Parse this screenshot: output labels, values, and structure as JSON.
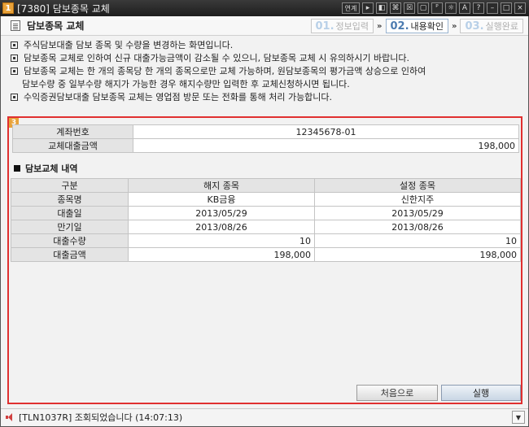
{
  "window": {
    "badge": "1",
    "title": "[7380] 담보종목 교체",
    "buttons": [
      "연계",
      "▸",
      "◧",
      "⌘",
      "☒",
      "▢",
      "ᴾ",
      "☼",
      "A",
      "?",
      "–",
      "□",
      "×"
    ]
  },
  "header": {
    "title": "담보종목 교체",
    "steps": [
      {
        "num": "01.",
        "label": "정보입력",
        "active": false
      },
      {
        "num": "02.",
        "label": "내용확인",
        "active": true
      },
      {
        "num": "03.",
        "label": "실행완료",
        "active": false
      }
    ],
    "arrow": "»"
  },
  "notices": [
    "주식담보대출 담보 종목 및 수량을 변경하는 화면입니다.",
    "담보종목 교체로 인하여 신규 대출가능금액이 감소될 수 있으니, 담보종목 교체 시 유의하시기 바랍니다.",
    "담보종목 교체는 한 개의 종목당 한 개의 종목으로만 교체 가능하며, 원담보종목의 평가금액 상승으로 인하여",
    "담보수량 중 일부수량 해지가 가능한 경우 해지수량만 입력한 후 교체신청하시면 됩니다.",
    "수익증권담보대출 담보종목 교체는 영업점 방문 또는 전화를 통해 처리 가능합니다."
  ],
  "panel": {
    "badge": "3",
    "account_label": "계좌번호",
    "account_value": "12345678-01",
    "loan_label": "교체대출금액",
    "loan_value": "198,000",
    "section_title": "담보교체 내역",
    "table": {
      "headers": [
        "구분",
        "해지 종목",
        "설정 종목"
      ],
      "rows": [
        {
          "label": "종목명",
          "cancel": "KB금융",
          "set": "신한지주"
        },
        {
          "label": "대출일",
          "cancel": "2013/05/29",
          "set": "2013/05/29"
        },
        {
          "label": "만기일",
          "cancel": "2013/08/26",
          "set": "2013/08/26"
        },
        {
          "label": "대출수량",
          "cancel": "10",
          "set": "10"
        },
        {
          "label": "대출금액",
          "cancel": "198,000",
          "set": "198,000"
        }
      ]
    },
    "btn_reset": "처음으로",
    "btn_execute": "실행"
  },
  "status": {
    "text": "[TLN1037R] 조회되었습니다 (14:07:13)"
  }
}
